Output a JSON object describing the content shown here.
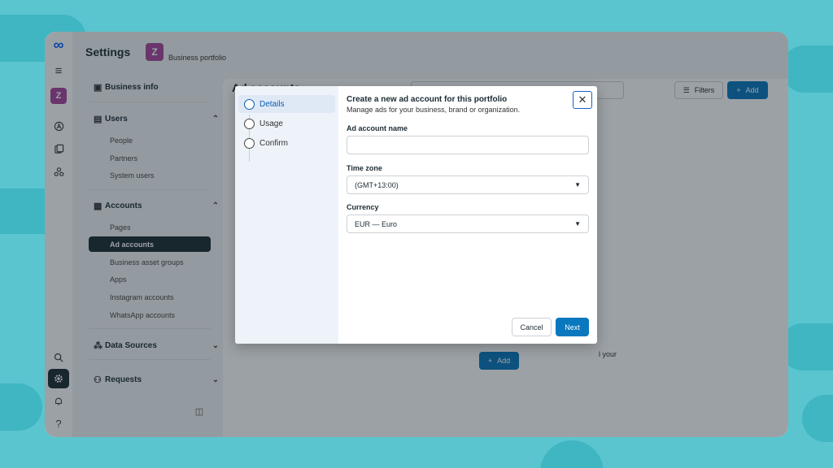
{
  "header": {
    "title": "Settings",
    "portfolio_initial": "Z",
    "portfolio_label": "Business portfolio"
  },
  "rail": {
    "logo": "∞",
    "menu": "≡",
    "avatar_initial": "Z",
    "help": "?"
  },
  "nav": {
    "business_info": "Business info",
    "users": {
      "label": "Users",
      "items": [
        "People",
        "Partners",
        "System users"
      ]
    },
    "accounts": {
      "label": "Accounts",
      "items": [
        "Pages",
        "Ad accounts",
        "Business asset groups",
        "Apps",
        "Instagram accounts",
        "WhatsApp accounts"
      ]
    },
    "data_sources": "Data Sources",
    "requests": "Requests"
  },
  "main": {
    "title": "Ad accounts",
    "filters_label": "Filters",
    "add_label": "Add",
    "empty_text_fragment": "l your",
    "empty_add_label": "Add"
  },
  "modal": {
    "steps": [
      "Details",
      "Usage",
      "Confirm"
    ],
    "title": "Create a new ad account for this portfolio",
    "subtitle": "Manage ads for your business, brand or organization.",
    "close": "✕",
    "fields": {
      "name_label": "Ad account name",
      "name_value": "",
      "timezone_label": "Time zone",
      "timezone_value": "(GMT+13:00)",
      "currency_label": "Currency",
      "currency_value": "EUR — Euro"
    },
    "cancel_label": "Cancel",
    "next_label": "Next"
  },
  "colors": {
    "accent": "#0a78be",
    "background": "#5ac5cf",
    "avatar": "#a9469e",
    "active_nav": "#1c2b33"
  }
}
